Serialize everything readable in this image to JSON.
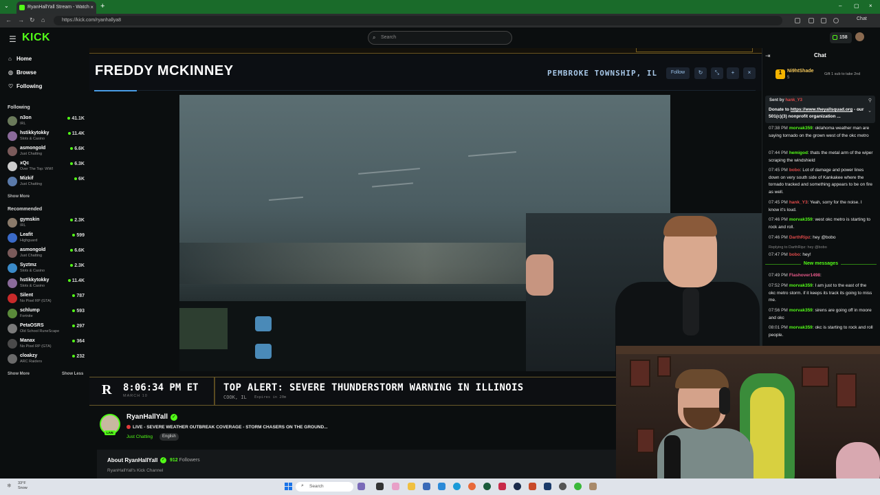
{
  "browser": {
    "tab_title": "RyanHallYall Stream - Watch",
    "url": "https://kick.com/ryanhallya8",
    "chat_button": "Chat"
  },
  "header": {
    "logo": "KICK",
    "search_placeholder": "Search",
    "viewer_count": "158"
  },
  "sidebar": {
    "nav": [
      {
        "label": "Home",
        "icon": "home-icon"
      },
      {
        "label": "Browse",
        "icon": "compass-icon"
      },
      {
        "label": "Following",
        "icon": "heart-icon"
      }
    ],
    "following_title": "Following",
    "following": [
      {
        "name": "n3on",
        "category": "IRL",
        "viewers": "41.1K",
        "color": "#6a7a5a"
      },
      {
        "name": "hstikkytokky",
        "category": "Slots & Casino",
        "viewers": "11.4K",
        "color": "#8a6a9a"
      },
      {
        "name": "asmongold",
        "category": "Just Chatting",
        "viewers": "6.6K",
        "color": "#7a5a5a"
      },
      {
        "name": "xQc",
        "category": "Over The Top: WWI",
        "viewers": "6.3K",
        "color": "#cccccc"
      },
      {
        "name": "Mizkif",
        "category": "Just Chatting",
        "viewers": "6K",
        "color": "#5a7aaa"
      }
    ],
    "show_more_1": "Show More",
    "recommended_title": "Recommended",
    "recommended": [
      {
        "name": "gymskin",
        "category": "IRL",
        "viewers": "2.3K",
        "color": "#8a7a6a"
      },
      {
        "name": "Leafit",
        "category": "Highguard",
        "viewers": "599",
        "color": "#3a6ac8"
      },
      {
        "name": "asmongold",
        "category": "Just Chatting",
        "viewers": "6.6K",
        "color": "#7a5a5a"
      },
      {
        "name": "Syztmz",
        "category": "Slots & Casino",
        "viewers": "2.3K",
        "color": "#3a8ac8"
      },
      {
        "name": "hstikkytokky",
        "category": "Slots & Casino",
        "viewers": "11.4K",
        "color": "#8a6a9a"
      },
      {
        "name": "Silent",
        "category": "No Pixel RP (GTA)",
        "viewers": "787",
        "color": "#c82a2a"
      },
      {
        "name": "schlump",
        "category": "Fortnite",
        "viewers": "593",
        "color": "#5a8a3a"
      },
      {
        "name": "PetaOSRS",
        "category": "Old School RuneScape",
        "viewers": "297",
        "color": "#7a7a7a"
      },
      {
        "name": "Manax",
        "category": "No Pixel RP (GTA)",
        "viewers": "364",
        "color": "#4a4a4a"
      },
      {
        "name": "cloakzy",
        "category": "ARC Raiders",
        "viewers": "232",
        "color": "#6a6a6a"
      }
    ],
    "show_more_2": "Show More",
    "show_less": "Show Less"
  },
  "overlay": {
    "name": "FREDDY MCKINNEY",
    "location": "PEMBROKE TOWNSHIP, IL",
    "follow": "Follow",
    "controls": [
      "↻",
      "⤡",
      "+",
      "×"
    ]
  },
  "alert": {
    "logo": "R",
    "time": "8:06:34 PM ET",
    "date": "MARCH 10",
    "title": "TOP ALERT: SEVERE THUNDERSTORM WARNING IN ILLINOIS",
    "location": "COOK, IL",
    "expires": "Expires in 20m"
  },
  "channel": {
    "name": "RyanHallYall",
    "live_badge": "LIVE",
    "title": "LIVE - SEVERE WEATHER OUTBREAK COVERAGE - STORM CHASERS ON THE GROUND...",
    "category": "Just Chatting",
    "language": "English",
    "about_title": "About RyanHallYall",
    "followers_count": "912",
    "followers_label": "Followers",
    "description": "RyanHallYall's Kick Channel"
  },
  "chat": {
    "title": "Chat",
    "gift": {
      "user": "Ni9htShade",
      "count": "5",
      "text": "Gift 1 sub to take 2nd"
    },
    "pinned": {
      "sent_by": "Sent by",
      "sender": "hank_Y3",
      "text_before": "Donate to ",
      "link": "https://www.theyallsquad.org",
      "text_after": " - our 501(c)(3) nonprofit organization ..."
    },
    "messages": [
      {
        "time": "07:38 PM",
        "user": "morvak359",
        "color": "#53fc18",
        "text": "oklahoma weather man are saying tornado on the grown west of the okc metro"
      },
      {
        "time": "07:44 PM",
        "user": "hemigod",
        "color": "#53fc18",
        "text": "thats the metal arm of the wiper scraping the windshield"
      },
      {
        "time": "07:45 PM",
        "user": "bobo",
        "color": "#e04a4a",
        "text": "Lot of damage and power lines down on very south side of Kankakee where the tornado tracked and something appears to be on fire as well."
      },
      {
        "time": "07:45 PM",
        "user": "hank_Y3",
        "color": "#e04a4a",
        "text": "Yeah, sorry for the noise. I know it's loud."
      },
      {
        "time": "07:46 PM",
        "user": "morvak359",
        "color": "#53fc18",
        "text": "west okc metro is starting to rock and roll."
      },
      {
        "time": "07:46 PM",
        "user": "DarthRipz",
        "color": "#e04a4a",
        "text": "hey @bobo"
      },
      {
        "time": "07:47 PM",
        "user": "bobo",
        "color": "#e04a4a",
        "text": "hey!",
        "reply": "Replying to DarthRipz: hey @bobo"
      }
    ],
    "new_messages": "New messages",
    "messages_after": [
      {
        "time": "07:49 PM",
        "user": "Flashover1498",
        "color": "#e85a8a",
        "text": ""
      },
      {
        "time": "07:52 PM",
        "user": "morvak359",
        "color": "#53fc18",
        "text": "I am just to the east of the okc metro storm. if it keeps its track its going to miss me."
      },
      {
        "time": "07:56 PM",
        "user": "morvak359",
        "color": "#53fc18",
        "text": "sirens are going off in moore and okc"
      },
      {
        "time": "08:01 PM",
        "user": "morvak359",
        "color": "#53fc18",
        "text": "okc is starting to rock and roll people."
      }
    ]
  },
  "taskbar": {
    "temp": "33°F",
    "condition": "Snow",
    "search": "Search"
  }
}
